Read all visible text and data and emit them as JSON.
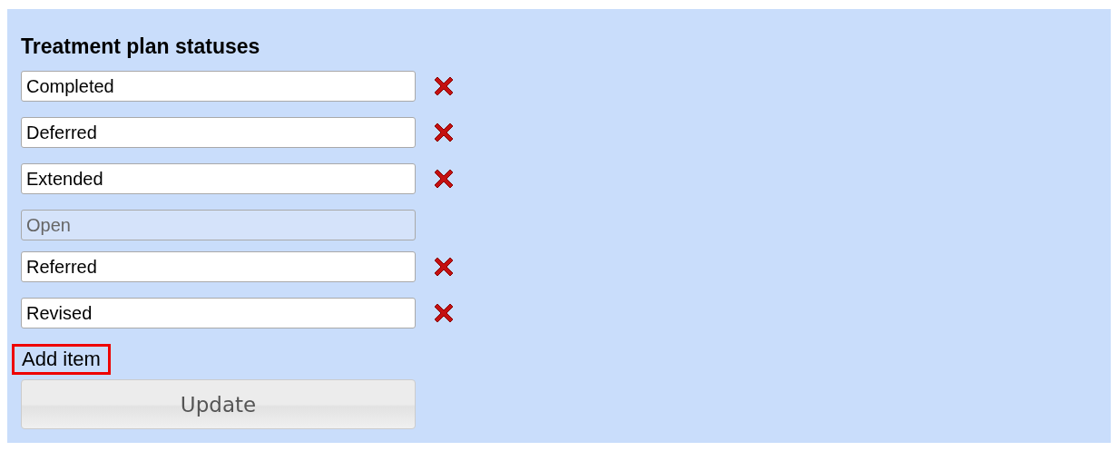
{
  "title": "Treatment plan statuses",
  "items": [
    {
      "value": "Completed",
      "disabled": false
    },
    {
      "value": "Deferred",
      "disabled": false
    },
    {
      "value": "Extended",
      "disabled": false
    },
    {
      "value": "Open",
      "disabled": true
    },
    {
      "value": "Referred",
      "disabled": false
    },
    {
      "value": "Revised",
      "disabled": false
    }
  ],
  "add_link": {
    "label": "Add item",
    "highlighted": true
  },
  "update_button": {
    "label": "Update"
  }
}
